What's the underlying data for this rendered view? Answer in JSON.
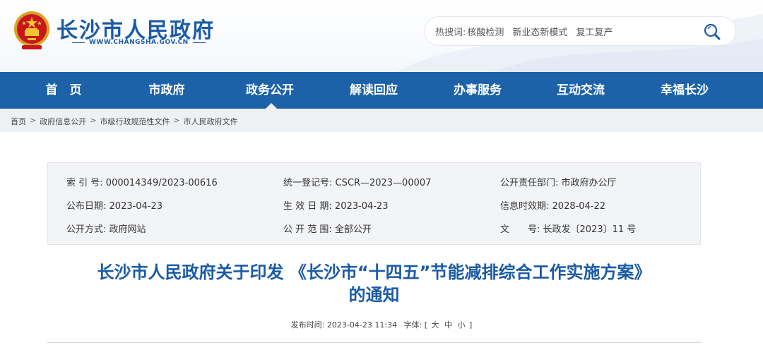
{
  "header": {
    "site_name": "长沙市人民政府",
    "site_url": "WWW.CHANGSHA.GOV.CN",
    "search": {
      "hot_label": "热搜词:",
      "hot_words": [
        "核酸检测",
        "新业态新模式",
        "复工复产"
      ]
    }
  },
  "nav": {
    "items": [
      "首　页",
      "市政府",
      "政务公开",
      "解读回应",
      "办事服务",
      "互动交流",
      "幸福长沙"
    ],
    "active": "政务公开"
  },
  "breadcrumb": {
    "items": [
      "首页",
      "政府信息公开",
      "市级行政规范性文件",
      "市人民政府文件"
    ],
    "separator": ">"
  },
  "info": {
    "index_no_label": "索 引 号:",
    "index_no": "000014349/2023-00616",
    "unified_reg_label": "统一登记号:",
    "unified_reg": "CSCR—2023—00007",
    "dept_label": "公开责任部门:",
    "dept": "市政府办公厅",
    "publish_date_label": "公布日期:",
    "publish_date": "2023-04-23",
    "effective_date_label": "生 效 日 期:",
    "effective_date": "2023-04-23",
    "expire_label": "信息时效期:",
    "expire": "2028-04-22",
    "public_method_label": "公开方式:",
    "public_method": "政府网站",
    "public_scope_label": "公 开 范 围:",
    "public_scope": "全部公开",
    "doc_no_label": "文　　号:",
    "doc_no": "长政发〔2023〕11 号"
  },
  "article": {
    "title_line1": "长沙市人民政府关于印发 《长沙市“十四五”节能减排综合工作实施方案》",
    "title_line2": "的通知",
    "publish_time_label": "发布时间:",
    "publish_time": "2023-04-23 11:34",
    "font_label": "字体:",
    "font_open": "[",
    "font_large": "大",
    "font_medium": "中",
    "font_small": "小",
    "font_close": "]"
  },
  "colors": {
    "brand_blue": "#1a5ba6",
    "nav_bg": "#1d62a9",
    "crumb_bg": "#eef1f4"
  }
}
